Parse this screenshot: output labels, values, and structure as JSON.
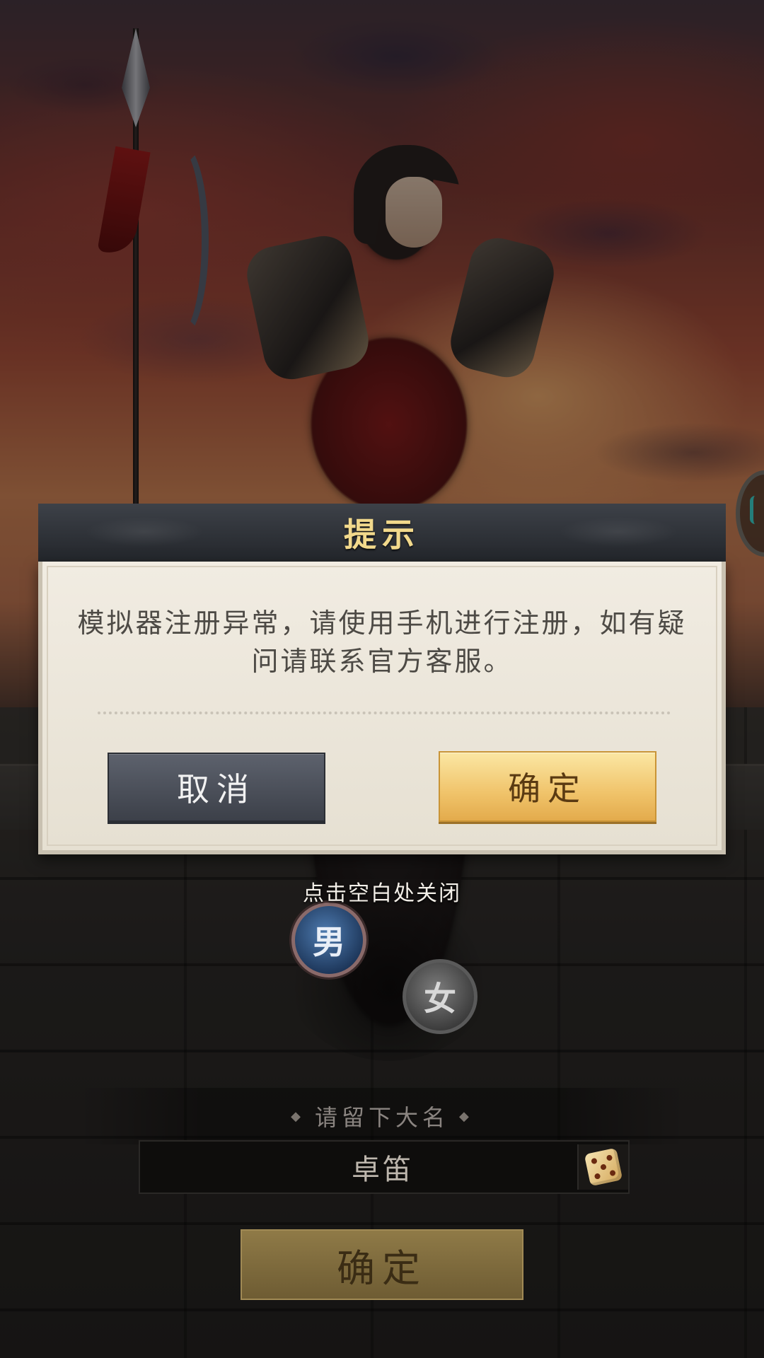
{
  "dialog": {
    "title": "提示",
    "message": "模拟器注册异常，请使用手机进行注册，如有疑问请联系官方客服。",
    "cancel_label": "取消",
    "confirm_label": "确定"
  },
  "overlay": {
    "close_hint": "点击空白处关闭"
  },
  "character_creation": {
    "gender_male_label": "男",
    "gender_female_label": "女",
    "selected_gender": "男",
    "name_prompt": "请留下大名",
    "name_value": "卓笛",
    "confirm_label": "确定"
  },
  "icons": {
    "random_name": "dice-icon",
    "side_menu": "side-ring-icon"
  },
  "colors": {
    "dialog_title": "#f2d98c",
    "confirm_button": "#f0c36a",
    "cancel_button": "#4a4e57",
    "side_accent": "#3ed9d2"
  }
}
